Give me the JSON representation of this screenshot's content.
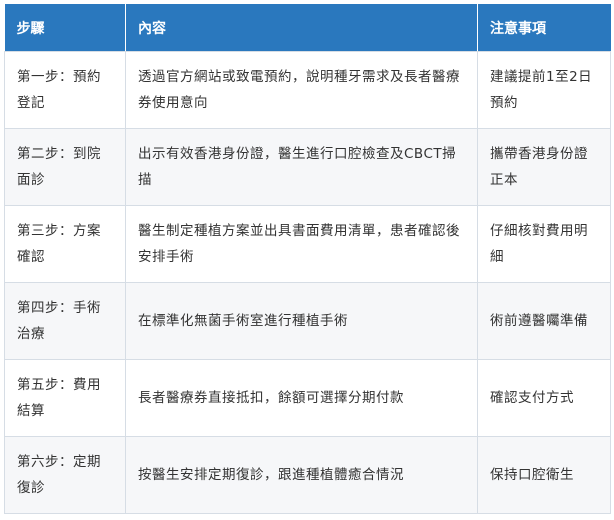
{
  "table": {
    "headers": [
      "步驟",
      "內容",
      "注意事項"
    ],
    "rows": [
      {
        "step": "第一步：預約登記",
        "content": "透過官方網站或致電預約，說明種牙需求及長者醫療券使用意向",
        "note": "建議提前1至2日預約"
      },
      {
        "step": "第二步：到院面診",
        "content": "出示有效香港身份證，醫生進行口腔檢查及CBCT掃描",
        "note": "攜帶香港身份證正本"
      },
      {
        "step": "第三步：方案確認",
        "content": "醫生制定種植方案並出具書面費用清單，患者確認後安排手術",
        "note": "仔細核對費用明細"
      },
      {
        "step": "第四步：手術治療",
        "content": "在標準化無菌手術室進行種植手術",
        "note": "術前遵醫囑準備"
      },
      {
        "step": "第五步：費用結算",
        "content": "長者醫療券直接抵扣，餘額可選擇分期付款",
        "note": "確認支付方式"
      },
      {
        "step": "第六步：定期復診",
        "content": "按醫生安排定期復診，跟進種植體癒合情況",
        "note": "保持口腔衛生"
      }
    ]
  },
  "colors": {
    "header_bg": "#2a78be",
    "header_text": "#ffffff",
    "border": "#d6dde5",
    "stripe": "#f6f7f9",
    "body_text": "#333333"
  }
}
